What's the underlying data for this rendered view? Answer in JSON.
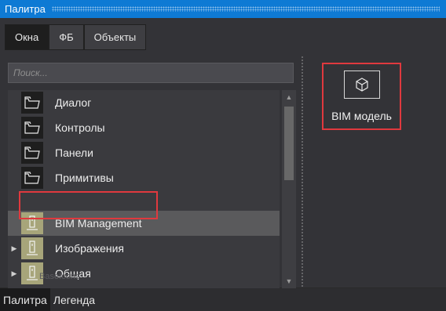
{
  "window": {
    "title": "Палитра"
  },
  "tabs": [
    {
      "label": "Окна",
      "active": true
    },
    {
      "label": "ФБ",
      "active": false
    },
    {
      "label": "Объекты",
      "active": false
    }
  ],
  "search": {
    "placeholder": "Поиск..."
  },
  "tree": {
    "items": [
      {
        "label": "Диалог",
        "icon": "folder-icon",
        "expandable": false,
        "selected": false
      },
      {
        "label": "Контролы",
        "icon": "folder-icon",
        "expandable": false,
        "selected": false
      },
      {
        "label": "Панели",
        "icon": "folder-icon",
        "expandable": false,
        "selected": false
      },
      {
        "label": "Примитивы",
        "icon": "folder-icon",
        "expandable": false,
        "selected": false
      },
      {
        "label": "BIM Management",
        "icon": "library-icon",
        "expandable": false,
        "selected": true
      },
      {
        "label": "Изображения",
        "icon": "library-icon",
        "expandable": true,
        "selected": false
      },
      {
        "label": "Общая",
        "icon": "library-icon",
        "expandable": true,
        "selected": false
      }
    ],
    "partial_item": "BaseIcons"
  },
  "palette_items": [
    {
      "label": "BIM модель",
      "icon": "cube-icon"
    }
  ],
  "bottom_tabs": [
    {
      "label": "Палитра",
      "active": true
    },
    {
      "label": "Легенда",
      "active": false
    }
  ],
  "colors": {
    "titlebar": "#0e7ad4",
    "highlight": "#e0393e",
    "selected_row": "#5a5a5c"
  }
}
